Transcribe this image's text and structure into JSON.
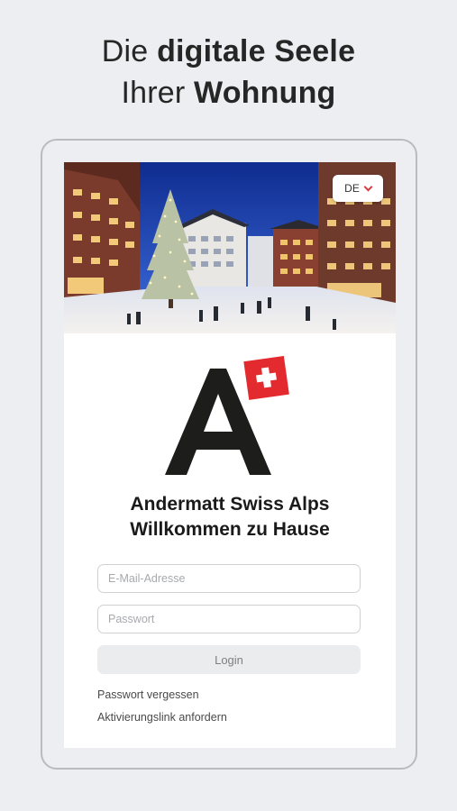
{
  "headline": {
    "line1_regular": "Die ",
    "line1_bold": "digitale Seele",
    "line2_regular": "Ihrer ",
    "line2_bold": "Wohnung"
  },
  "language_selector": {
    "value": "DE"
  },
  "app": {
    "title_line1": "Andermatt Swiss Alps",
    "title_line2": "Willkommen zu Hause"
  },
  "form": {
    "email_placeholder": "E-Mail-Adresse",
    "password_placeholder": "Passwort",
    "login_label": "Login",
    "forgot_password": "Passwort vergessen",
    "request_activation": "Aktivierungslink anfordern"
  },
  "colors": {
    "accent_red": "#e32a2f",
    "logo_black": "#1d1d1b",
    "background": "#eceef1"
  }
}
